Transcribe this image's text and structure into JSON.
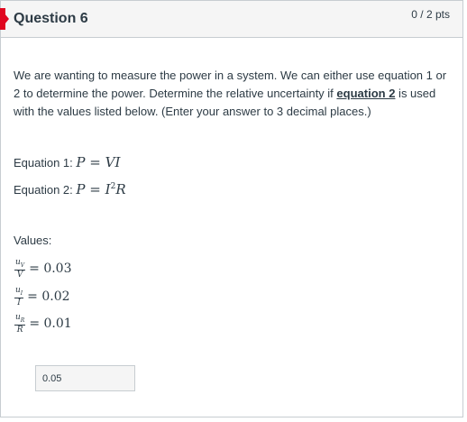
{
  "question": {
    "title": "Question 6",
    "points": "0 / 2 pts"
  },
  "prompt": {
    "before_link": "We are wanting to measure the power in a system. We can either use equation 1 or 2 to determine the power. Determine the relative uncertainty if ",
    "link": "equation 2",
    "after_link": " is used with the values listed below. (Enter your answer to 3 decimal places.)"
  },
  "equations": [
    {
      "label": "Equation 1:",
      "lhs": "P",
      "rhs": "VI",
      "superscript": ""
    },
    {
      "label": "Equation 2:",
      "lhs": "P",
      "rhs_base": "I",
      "superscript": "2",
      "rhs_tail": "R"
    }
  ],
  "values": {
    "label": "Values:",
    "items": [
      {
        "num": "u",
        "num_sub": "V",
        "den": "V",
        "value": "0.03"
      },
      {
        "num": "u",
        "num_sub": "I",
        "den": "I",
        "value": "0.02"
      },
      {
        "num": "u",
        "num_sub": "R",
        "den": "R",
        "value": "0.01"
      }
    ]
  },
  "answer": {
    "value": "0.05"
  },
  "colors": {
    "flag": "#e0061f",
    "header_bg": "#f5f5f5",
    "border": "#c7cdd1",
    "text": "#2d3b45"
  }
}
